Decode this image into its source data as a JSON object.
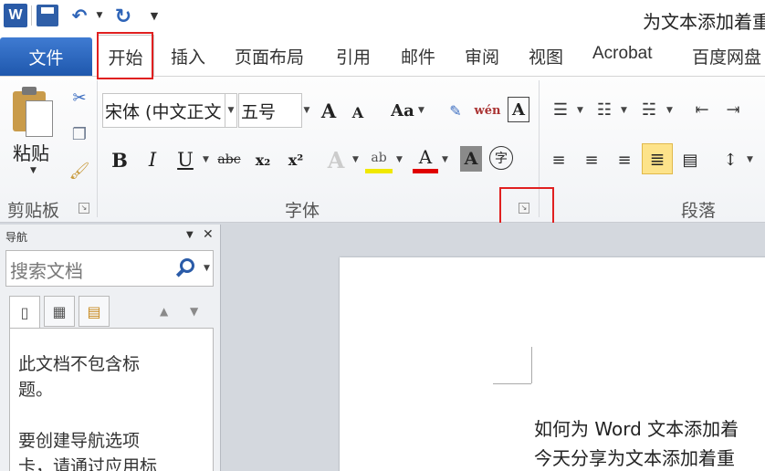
{
  "titlebar": {
    "app_logo": "W",
    "window_title": "为文本添加着重",
    "icons": [
      "word-logo-icon",
      "save-icon",
      "undo-icon",
      "redo-icon",
      "customize-menu-icon"
    ]
  },
  "tabs": {
    "file": "文件",
    "home": "开始",
    "items": [
      "插入",
      "页面布局",
      "引用",
      "邮件",
      "审阅",
      "视图",
      "Acrobat",
      "百度网盘"
    ]
  },
  "ribbon": {
    "clipboard": {
      "paste": "粘贴",
      "label": "剪贴板"
    },
    "font": {
      "font_name": "宋体 (中文正文",
      "font_size": "五号",
      "label": "字体",
      "buttons": {
        "bold": "B",
        "italic": "I",
        "underline": "U",
        "strike": "abc",
        "sub": "x₂",
        "sup": "x²",
        "grow": "A",
        "shrink": "A",
        "case": "Aa",
        "phonetic": "wén",
        "border": "A",
        "effect": "A",
        "highlight": "ab",
        "color": "A",
        "shade": "A",
        "enclose": "字"
      }
    },
    "paragraph": {
      "label": "段落"
    }
  },
  "nav": {
    "title": "导航",
    "search_placeholder": "搜索文档",
    "lines": [
      "此文档不包含标",
      "题。",
      "要创建导航选项",
      "卡，请通过应用标"
    ]
  },
  "document": {
    "lines": [
      "如何为 Word 文本添加着",
      "今天分享为文本添加着重"
    ]
  },
  "colors": {
    "accent": "#2a5ba8",
    "highlight": "#e02020",
    "file_tab": "#2b66c0"
  }
}
